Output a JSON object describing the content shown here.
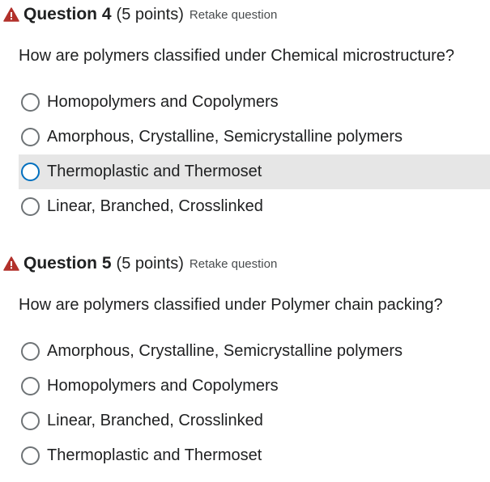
{
  "colors": {
    "warning_icon": "#b2312b",
    "hover_background": "#e6e6e6",
    "hover_radio_border": "#006fbf",
    "radio_border": "#6e7376",
    "text": "#202122",
    "retake_text": "#494c4e"
  },
  "questions": [
    {
      "icon": "warning-triangle-icon",
      "title": "Question 4",
      "points": "(5 points)",
      "retake_label": "Retake question",
      "text": "How are polymers classified under Chemical microstructure?",
      "options": [
        {
          "label": "Homopolymers and Copolymers",
          "selected": false,
          "hovered": false
        },
        {
          "label": "Amorphous, Crystalline, Semicrystalline polymers",
          "selected": false,
          "hovered": false
        },
        {
          "label": "Thermoplastic and Thermoset",
          "selected": false,
          "hovered": true
        },
        {
          "label": "Linear, Branched, Crosslinked",
          "selected": false,
          "hovered": false
        }
      ]
    },
    {
      "icon": "warning-triangle-icon",
      "title": "Question 5",
      "points": "(5 points)",
      "retake_label": "Retake question",
      "text": "How are polymers classified under Polymer chain packing?",
      "options": [
        {
          "label": "Amorphous, Crystalline, Semicrystalline polymers",
          "selected": false,
          "hovered": false
        },
        {
          "label": "Homopolymers and Copolymers",
          "selected": false,
          "hovered": false
        },
        {
          "label": "Linear, Branched, Crosslinked",
          "selected": false,
          "hovered": false
        },
        {
          "label": "Thermoplastic and Thermoset",
          "selected": false,
          "hovered": false
        }
      ]
    }
  ]
}
